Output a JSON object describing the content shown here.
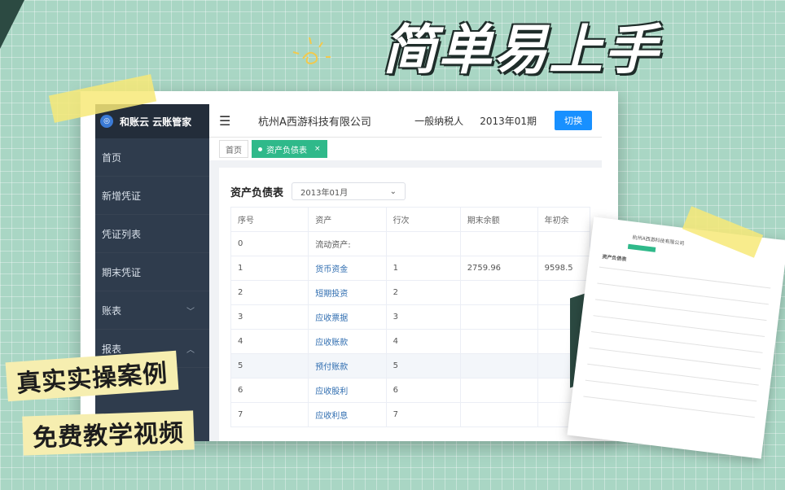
{
  "headline": "简单易上手",
  "banners": {
    "line1": "真实实操案例",
    "line2": "免费教学视频"
  },
  "app": {
    "brand": "和账云 云账管家",
    "company": "杭州A西游科技有限公司",
    "taxpayer_type": "一般纳税人",
    "period": "2013年01期",
    "switch_label": "切换"
  },
  "sidebar": {
    "items": [
      {
        "label": "首页"
      },
      {
        "label": "新增凭证"
      },
      {
        "label": "凭证列表"
      },
      {
        "label": "期末凭证"
      },
      {
        "label": "账表",
        "chevron": "chevron-down-icon"
      },
      {
        "label": "报表",
        "chevron": "chevron-up-icon"
      }
    ]
  },
  "tabs": [
    {
      "label": "首页"
    },
    {
      "label": "资产负债表",
      "close": "×"
    }
  ],
  "report": {
    "title": "资产负债表",
    "period_select": "2013年01月",
    "columns": [
      "序号",
      "资产",
      "行次",
      "期末余额",
      "年初余"
    ],
    "rows": [
      {
        "no": "0",
        "asset": "流动资产:",
        "line": "",
        "end": "",
        "begin": ""
      },
      {
        "no": "1",
        "asset": "货币资金",
        "line": "1",
        "end": "2759.96",
        "begin": "9598.5"
      },
      {
        "no": "2",
        "asset": "短期投资",
        "line": "2",
        "end": "",
        "begin": ""
      },
      {
        "no": "3",
        "asset": "应收票据",
        "line": "3",
        "end": "",
        "begin": ""
      },
      {
        "no": "4",
        "asset": "应收账款",
        "line": "4",
        "end": "",
        "begin": ""
      },
      {
        "no": "5",
        "asset": "预付账款",
        "line": "5",
        "end": "",
        "begin": ""
      },
      {
        "no": "6",
        "asset": "应收股利",
        "line": "6",
        "end": "",
        "begin": ""
      },
      {
        "no": "7",
        "asset": "应收利息",
        "line": "7",
        "end": "",
        "begin": ""
      }
    ]
  },
  "paper": {
    "title": "杭州A西游科技有限公司",
    "subtitle": "资产负债表"
  },
  "colors": {
    "accent": "#1890ff",
    "tab_active": "#2fb98a",
    "sidebar": "#2f3c4d",
    "background": "#a9d6c4"
  }
}
